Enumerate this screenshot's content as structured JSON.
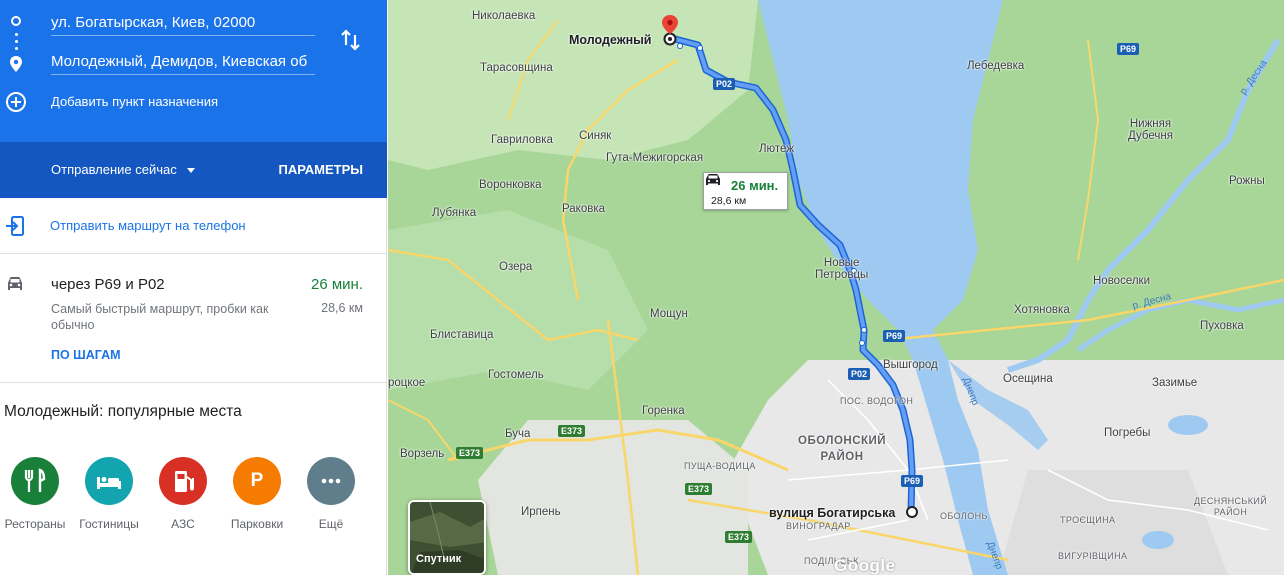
{
  "directions": {
    "origin_value": "ул. Богатырская, Киев, 02000",
    "destination_value": "Молодежный, Демидов, Киевская об",
    "add_destination_label": "Добавить пункт назначения",
    "depart_label": "Отправление сейчас",
    "options_label": "ПАРАМЕТРЫ",
    "send_to_phone_label": "Отправить маршрут на телефон"
  },
  "route": {
    "via": "через P69 и P02",
    "time": "26 мин.",
    "description": "Самый быстрый маршрут, пробки как обычно",
    "distance": "28,6 км",
    "steps_label": "ПО ШАГАМ"
  },
  "places": {
    "title": "Молодежный: популярные места",
    "items": [
      {
        "label": "Рестораны",
        "icon": "fork-knife-icon",
        "color": "#188038"
      },
      {
        "label": "Гостиницы",
        "icon": "bed-icon",
        "color": "#12a4af"
      },
      {
        "label": "АЗС",
        "icon": "gas-station-icon",
        "color": "#d93025"
      },
      {
        "label": "Парковки",
        "icon": "parking-icon",
        "color": "#f57c00"
      },
      {
        "label": "Ещё",
        "icon": "more-icon",
        "color": "#607d8b"
      }
    ]
  },
  "map": {
    "tooltip": {
      "time": "26 мин.",
      "distance": "28,6 км"
    },
    "labels": {
      "nikolaevka": "Николаевка",
      "molodezhny": "Молодежный",
      "tarasovshchina": "Тарасовщина",
      "lebedevka": "Лебедевка",
      "nyzhnya_dubechnya": "Нижняя\nДубечня",
      "gavrilovka": "Гавриловка",
      "sinyak": "Синяк",
      "guta": "Гута-Межигорская",
      "lyutezh": "Лютеж",
      "voronkovka": "Воронковка",
      "rakovka": "Раковка",
      "lubyanka": "Лубянка",
      "ozera": "Озера",
      "novye_petrovtsy": "Новые\nПетровцы",
      "novoselki": "Новоселки",
      "rozhny": "Рожны",
      "moshchun": "Мощун",
      "khotyanovka": "Хотяновка",
      "pukhovka": "Пуховка",
      "blistavitsa": "Блиставица",
      "vyshgorod": "Вышгород",
      "osetshchina": "Осещина",
      "zazimye": "Зазимье",
      "gostomel": "Гостомель",
      "gorenka": "Горенка",
      "buchaa": "Буча",
      "obolonsky": "ОБОЛОНСКИЙ\nРАЙОН",
      "pogrebyi": "Погребы",
      "vorzel": "Ворзель",
      "pushcha": "ПУЩА-ВОДИЦА",
      "irpin": "Ирпень",
      "bogatyrska": "вулиця Богатирська",
      "vinogradar": "ВИНОГРАДАР",
      "obolon": "ОБОЛОНЬ",
      "desnyansky": "ДЕСНЯНСЬКИЙ\nРАЙОН",
      "troeshchina": "ТРОЄЩИНА",
      "vigurovshchina": "ВИГУРІВЩИНА",
      "podilsky": "ПОДІЛЬСЬК",
      "vodogon": "ПОС. ВОДОГОН",
      "rotskoe": "роцкое",
      "river_desna_1": "р. Десна",
      "river_desna_2": "р. Десна",
      "river_dnepr": "Днепр",
      "river_dnepr_2": "Днепр"
    },
    "shields": {
      "p69a": "P69",
      "p02a": "P02",
      "p69b": "P69",
      "p02b": "P02",
      "p69c": "P69",
      "e373a": "E373",
      "e373b": "E373",
      "e373c": "E373",
      "e373d": "E373"
    },
    "satellite_label": "Спутник",
    "logo_text": "Google"
  },
  "colors": {
    "accent": "#1a73e8",
    "accent_dark": "#1557c0",
    "route_time": "#188038",
    "water": "#9ec9f0",
    "land": "#a8d698",
    "urban": "#e8e8e8"
  }
}
